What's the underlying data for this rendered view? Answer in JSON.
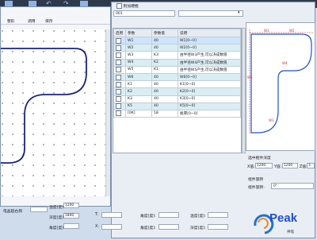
{
  "dialog": {
    "menu": [
      "整形",
      "调用",
      "保存"
    ],
    "bottom_label": "电晶超右侧"
  },
  "main": {
    "checkbox_label": "附加硬瓶",
    "combo_value": "001",
    "table_headers": [
      "启用",
      "参数",
      "参数值",
      "说明"
    ],
    "rows": [
      {
        "param": "W1",
        "value": "40",
        "desc": "W1[0~0]"
      },
      {
        "param": "W2",
        "value": "40",
        "desc": "W2[0~0]"
      },
      {
        "param": "W3",
        "value": "K3",
        "desc": "由半径W3产生,可以决成数值"
      },
      {
        "param": "W4",
        "value": "K2",
        "desc": "由半径W4产生,可以决成数值"
      },
      {
        "param": "W5",
        "value": "K1",
        "desc": "由半径W5产生,可以决成数值"
      },
      {
        "param": "W6",
        "value": "40",
        "desc": "W6[0~0]"
      },
      {
        "param": "K1",
        "value": "40",
        "desc": "K1[0~0]"
      },
      {
        "param": "K2",
        "value": "40",
        "desc": "K2[0~0]"
      },
      {
        "param": "K3",
        "value": "40",
        "desc": "K3[0~0]"
      },
      {
        "param": "K5",
        "value": "40",
        "desc": "K5[0~0]"
      },
      {
        "param": "[0K]",
        "value": "18",
        "desc": "板厚[0~0]"
      }
    ],
    "dims": {
      "temp_label": "温度(度):",
      "temp_value": "1200",
      "depth_label": "深度(度):",
      "depth_value": "1800",
      "corner_label": "角度(度):",
      "t_label": "T:",
      "x_label": "X:"
    }
  },
  "right": {
    "section1_title": "选中框件深度",
    "x_label": "X值:",
    "x_value": "1200",
    "y_label": "Y值:",
    "y_value": "1200",
    "z_label": "Z值:",
    "z_value": "3",
    "section2_title": "组件旋转",
    "rotate_label": "组件旋转:",
    "rotate_value": "0°",
    "dim_labels": {
      "top1": "W1",
      "top2": "W2",
      "side": "W5",
      "inner": "W4",
      "center": "W3"
    }
  },
  "logo": {
    "text": "Peak",
    "subtext": "神笔"
  },
  "colors": {
    "accent": "#1f4fd6",
    "dark_bar": "#2e3a4c",
    "row_alt": "#d9eef3"
  }
}
